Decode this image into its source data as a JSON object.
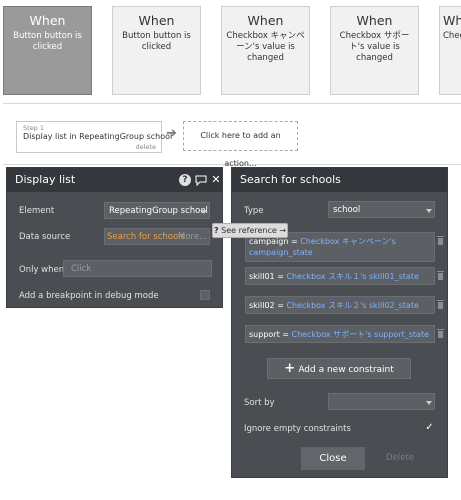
{
  "events": [
    {
      "title": "When",
      "subtitle": "Button button is clicked"
    },
    {
      "title": "When",
      "subtitle": "Button button is clicked"
    },
    {
      "title": "When",
      "subtitle": "Checkbox キャンペーン's value is changed"
    },
    {
      "title": "When",
      "subtitle": "Checkbox サポート's value is changed"
    },
    {
      "title": "When",
      "subtitle": "Checke"
    }
  ],
  "step": {
    "label": "Step 1",
    "text": "Display list in RepeatingGroup school",
    "delete": "delete"
  },
  "add_action": "Click here to add an action...",
  "display_panel": {
    "title": "Display list",
    "element_label": "Element",
    "element_value": "RepeatingGroup school",
    "datasource_label": "Data source",
    "datasource_value": "Search for schools",
    "datasource_more": "More...",
    "onlywhen_label": "Only when",
    "onlywhen_placeholder": "Click",
    "breakpoint_label": "Add a breakpoint in debug mode"
  },
  "tooltip": "See reference →",
  "search_panel": {
    "title": "Search for schools",
    "type_label": "Type",
    "type_value": "school",
    "constraints": [
      {
        "key": "campaign =",
        "value": "Checkbox キャンペーン's campaign_state"
      },
      {
        "key": "skill01 =",
        "value": "Checkbox スキル１'s skill01_state"
      },
      {
        "key": "skill02 =",
        "value": "Checkbox スキル２'s skill02_state"
      },
      {
        "key": "support =",
        "value": "Checkbox サポート's support_state"
      }
    ],
    "add_constraint": "Add a new constraint",
    "sortby_label": "Sort by",
    "ignore_label": "Ignore empty constraints",
    "close": "Close",
    "delete": "Delete"
  },
  "colors": {
    "panel": "#4a4d52",
    "header": "#34373b",
    "link": "#7fb3ff",
    "accent": "#f0a040"
  }
}
